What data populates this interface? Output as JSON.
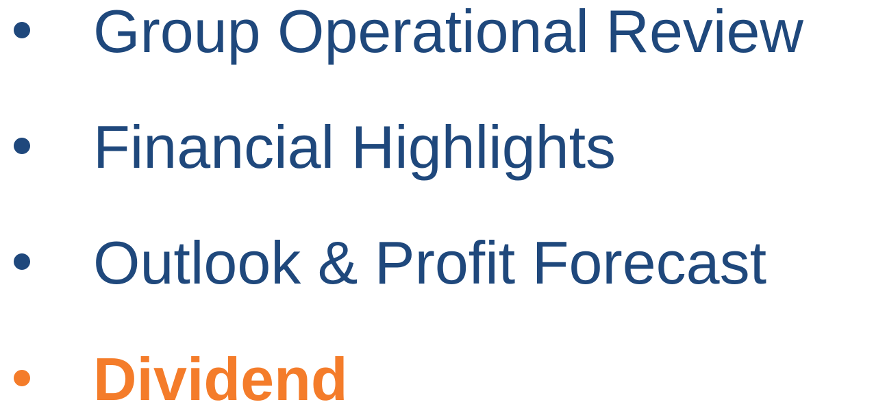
{
  "agenda": {
    "items": [
      {
        "label": "Group Operational Review",
        "highlighted": false
      },
      {
        "label": "Financial Highlights",
        "highlighted": false
      },
      {
        "label": "Outlook & Profit Forecast",
        "highlighted": false
      },
      {
        "label": "Dividend",
        "highlighted": true
      }
    ]
  },
  "colors": {
    "primary": "#1f487c",
    "highlight": "#f47c2a",
    "background": "#ffffff"
  }
}
